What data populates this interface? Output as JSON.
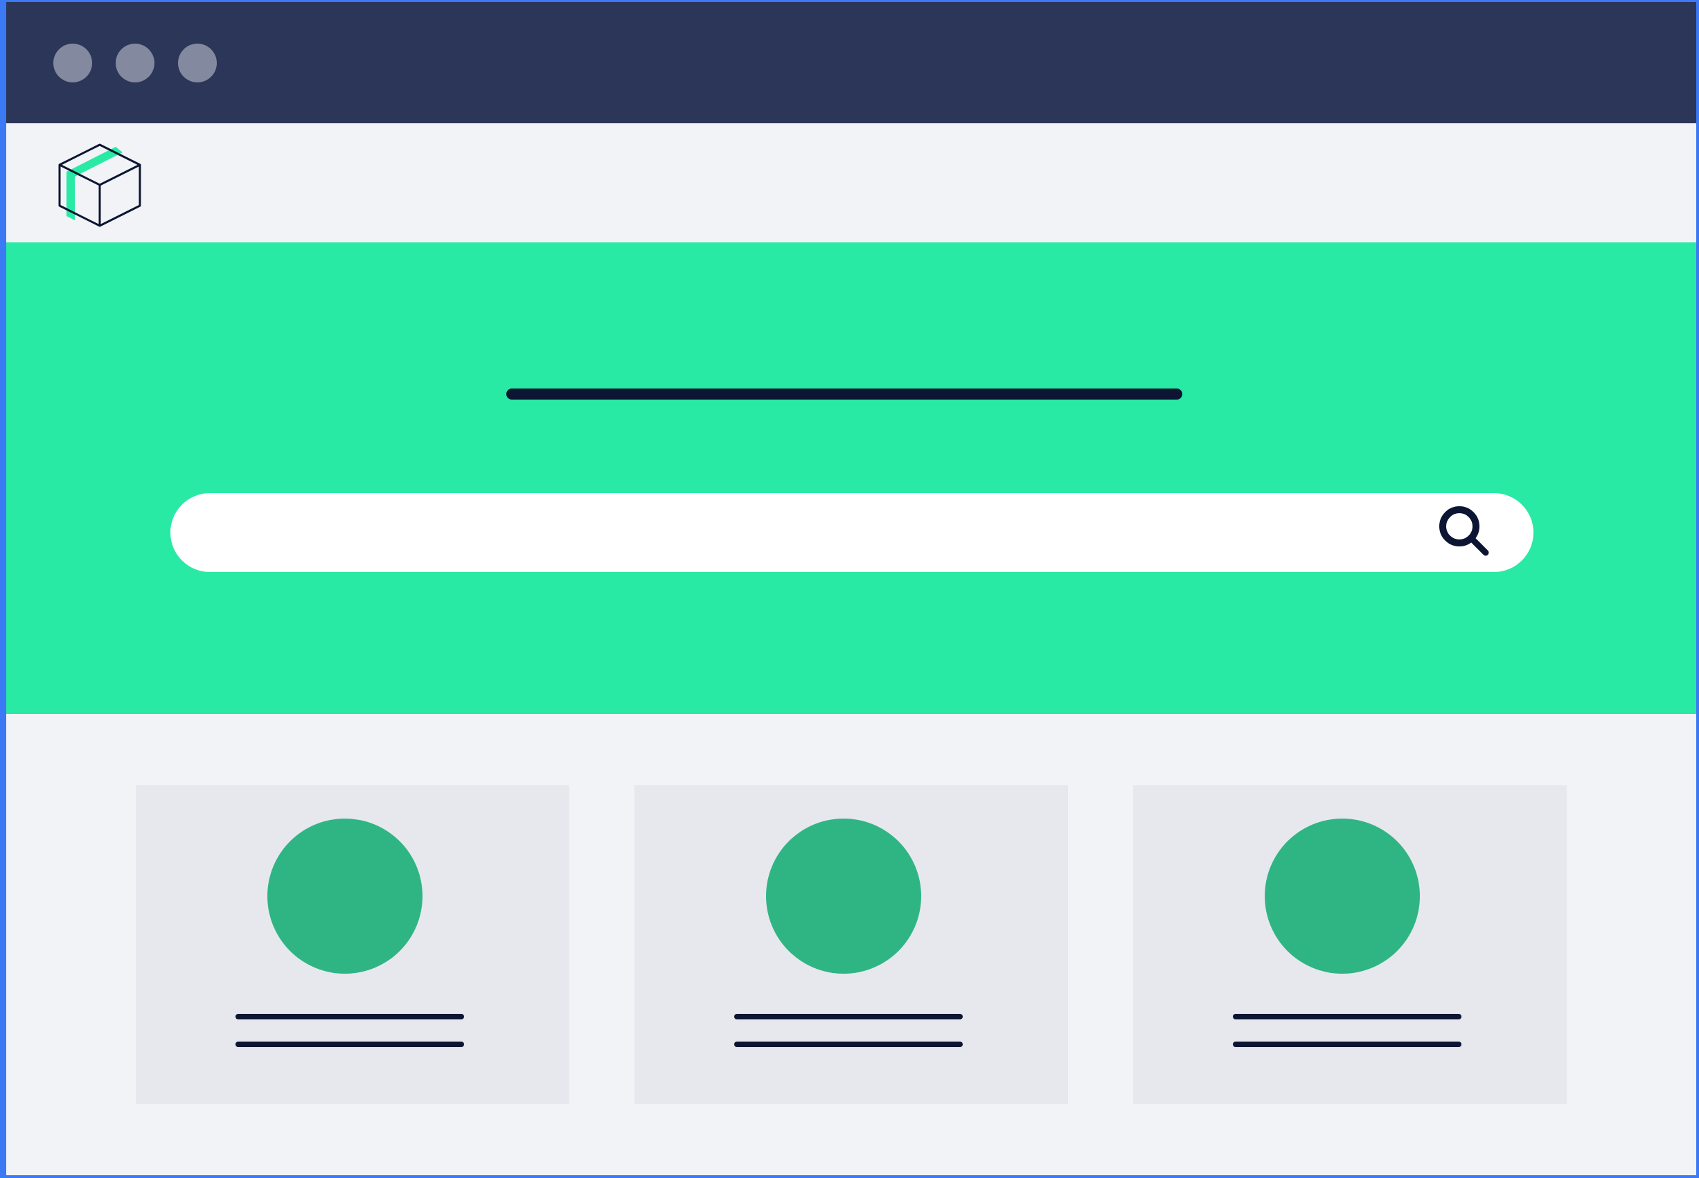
{
  "window": {
    "controls": [
      "close",
      "minimize",
      "maximize"
    ]
  },
  "header": {
    "logo_icon": "box-cube-icon",
    "logo_accent_color": "#29eaa5"
  },
  "hero": {
    "background_color": "#29eaa5",
    "headline_text": "",
    "search": {
      "value": "",
      "placeholder": "",
      "icon": "search-icon"
    }
  },
  "cards": [
    {
      "title": "",
      "subtitle": "",
      "avatar_color": "#2fb584"
    },
    {
      "title": "",
      "subtitle": "",
      "avatar_color": "#2fb584"
    },
    {
      "title": "",
      "subtitle": "",
      "avatar_color": "#2fb584"
    }
  ],
  "colors": {
    "titlebar": "#2b3658",
    "window_control": "#838aa0",
    "page_background": "#f2f3f7",
    "card_background": "#e7e8ed",
    "ink": "#0c1633",
    "outer_border": "#3b79f5"
  }
}
